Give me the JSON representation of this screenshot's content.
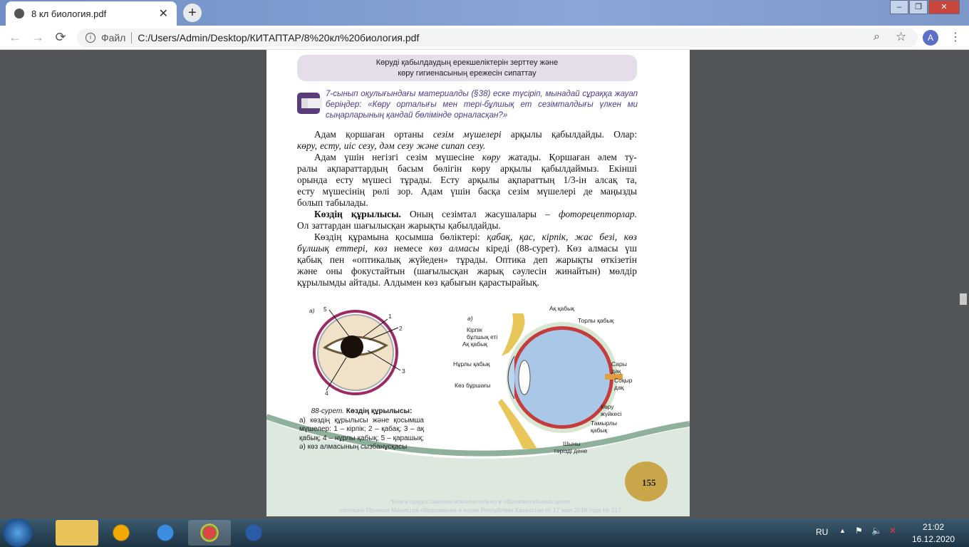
{
  "browser": {
    "tab_title": "8 кл биология.pdf",
    "new_tab": "+",
    "address_label": "Файл",
    "url": "C:/Users/Admin/Desktop/КИТАПТАР/8%20кл%20биология.pdf",
    "avatar": "A",
    "window_controls": [
      "–",
      "❐",
      "✕"
    ],
    "icons": [
      "globe-icon",
      "back-icon",
      "forward-icon",
      "reload-icon",
      "info-icon",
      "zoom-icon",
      "star-icon",
      "menu-icon"
    ]
  },
  "pdf": {
    "header": [
      "Көруді қабылдаудың ерекшеліктерін зерттеу және",
      "көру гигиенасының ережесін сипаттау"
    ],
    "question": "7-сынып оқулығындағы материалды (§38) еске түсіріп, мынадай сұраққа жауап беріңдер: «Көру орталығы мен тері-бұлшық ет сезімталдығы үлкен ми сыңарларының қандай бөлімінде орналасқан?»",
    "body_lines": [
      [
        [
          "",
          "Адам қоршаған ортаны "
        ],
        [
          "i",
          "сезім мүшелері"
        ],
        [
          "",
          "арқылы қабылдайды. Олар:"
        ]
      ],
      [
        [
          "i",
          "көру, есту, иіс сезу, дәм сезу және сипап сезу."
        ]
      ],
      [
        [
          "",
          "Адам үшін негізгі сезім мүшесіне "
        ],
        [
          "i",
          "көру"
        ],
        [
          "",
          "жатады. Қоршаған әлем ту-"
        ]
      ],
      [
        [
          "",
          "ралы ақпараттардың басым бөлігін көру арқылы қабылдаймыз. Екінші"
        ]
      ],
      [
        [
          "",
          "орында есту мүшесі тұрады. Есту арқылы ақпараттың 1/3-ін алсақ та,"
        ]
      ],
      [
        [
          "",
          "есту мүшесінің рөлі зор. Адам үшін басқа сезім мүшелері де маңызды"
        ]
      ],
      [
        [
          "",
          "болып табылады."
        ]
      ],
      [
        [
          "b",
          "Көздің құрылысы."
        ],
        [
          "",
          "Оның сезімтал жасушалары – "
        ],
        [
          "i",
          "фоторецепторлар."
        ]
      ],
      [
        [
          "",
          "Ол заттардан шағылысқан жарықты қабылдайды."
        ]
      ],
      [
        [
          "",
          "Көздің құрамына қосымша бөліктері: "
        ],
        [
          "i",
          "қабақ, қас, кірпік, жас безі, көз"
        ]
      ],
      [
        [
          "i",
          "бұлшық еттері, көз"
        ],
        [
          "",
          "немесе "
        ],
        [
          "i",
          "көз алмасы"
        ],
        [
          "",
          "кіреді (88-сурет). Көз алмасы үш"
        ]
      ],
      [
        [
          "",
          "қабық пен «оптикалық жүйеден» тұрады. Оптика деп жарықты өткізетін"
        ]
      ],
      [
        [
          "",
          "және оны фокустайтын (шағылысқан жарық сәулесін жинайтын) мөлдір"
        ]
      ],
      [
        [
          "",
          "құрылымды айтады. Алдымен көз қабығын қарастырайық."
        ]
      ]
    ],
    "figure_a": {
      "label": "а)",
      "numbers": [
        "1",
        "2",
        "3",
        "4",
        "5"
      ]
    },
    "figure_b": {
      "label": "ә)",
      "labels": [
        "Ақ қабық",
        "Торлы қабық",
        "Кірпік",
        "бұлшық еті",
        "Ақ қабық",
        "Нұрлы қабық",
        "Көз бұршағы",
        "Сары",
        "дақ",
        "Соқыр",
        "дақ",
        "Көру",
        "жүйкесі",
        "Тамырлы",
        "қабық",
        "Шыны",
        "тәрізді дене"
      ]
    },
    "caption": {
      "num": "88-сурет.",
      "title": "Көздің құрылысы:",
      "text": "а) көздің құрылысы және қосымша мүшелер: 1 – кірпік; 2 – қабақ; 3 – ақ қабық; 4 – нұрлы қабық; 5 – қарашық; ә) көз алмасының сызбанұсқасы"
    },
    "page_number": "155",
    "watermark": [
      "*Книга предоставлена исключительно в образовательных целях",
      "согласно Приказа Министра образования и науки Республики Казахстан от 17 мая 2019 года № 217"
    ]
  },
  "taskbar": {
    "apps": [
      "explorer",
      "aimp",
      "internet-explorer",
      "chrome",
      "word"
    ],
    "language": "RU",
    "time": "21:02",
    "date": "16.12.2020"
  }
}
